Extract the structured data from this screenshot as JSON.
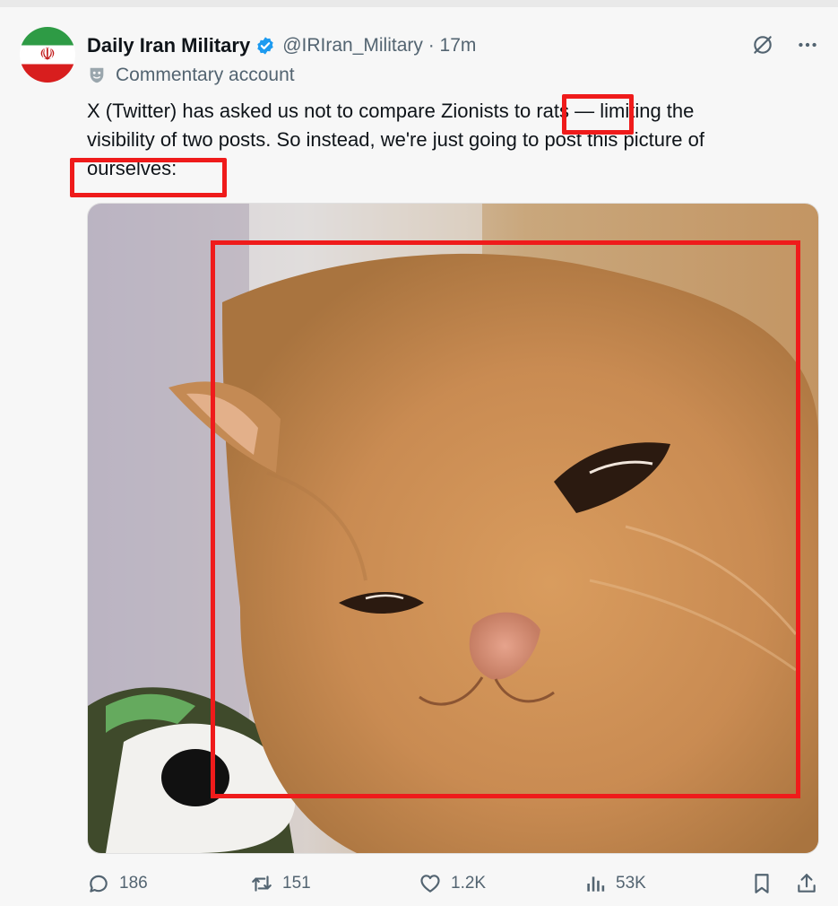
{
  "tweet": {
    "author_name": "Daily Iran Military",
    "handle_time": "@IRIran_Military · 17m",
    "label": "Commentary account",
    "text_line1": "X (Twitter) has asked us not to compare Zionists to rats — limiting the",
    "text_line2": "visibility of two posts. So instead, we're just going to post this picture of",
    "text_line3": "ourselves:",
    "avatar_emblem": "☫"
  },
  "stats": {
    "replies": "186",
    "reposts": "151",
    "likes": "1.2K",
    "views": "53K"
  },
  "colors": {
    "highlight_box": "#ef1b1b",
    "verified_badge": "#1d9bf0",
    "secondary_text": "#536471"
  },
  "icons": [
    "verified-badge-icon",
    "grok-icon",
    "more-icon",
    "mask-icon",
    "reply-icon",
    "repost-icon",
    "like-icon",
    "views-icon",
    "bookmark-icon",
    "share-icon"
  ]
}
